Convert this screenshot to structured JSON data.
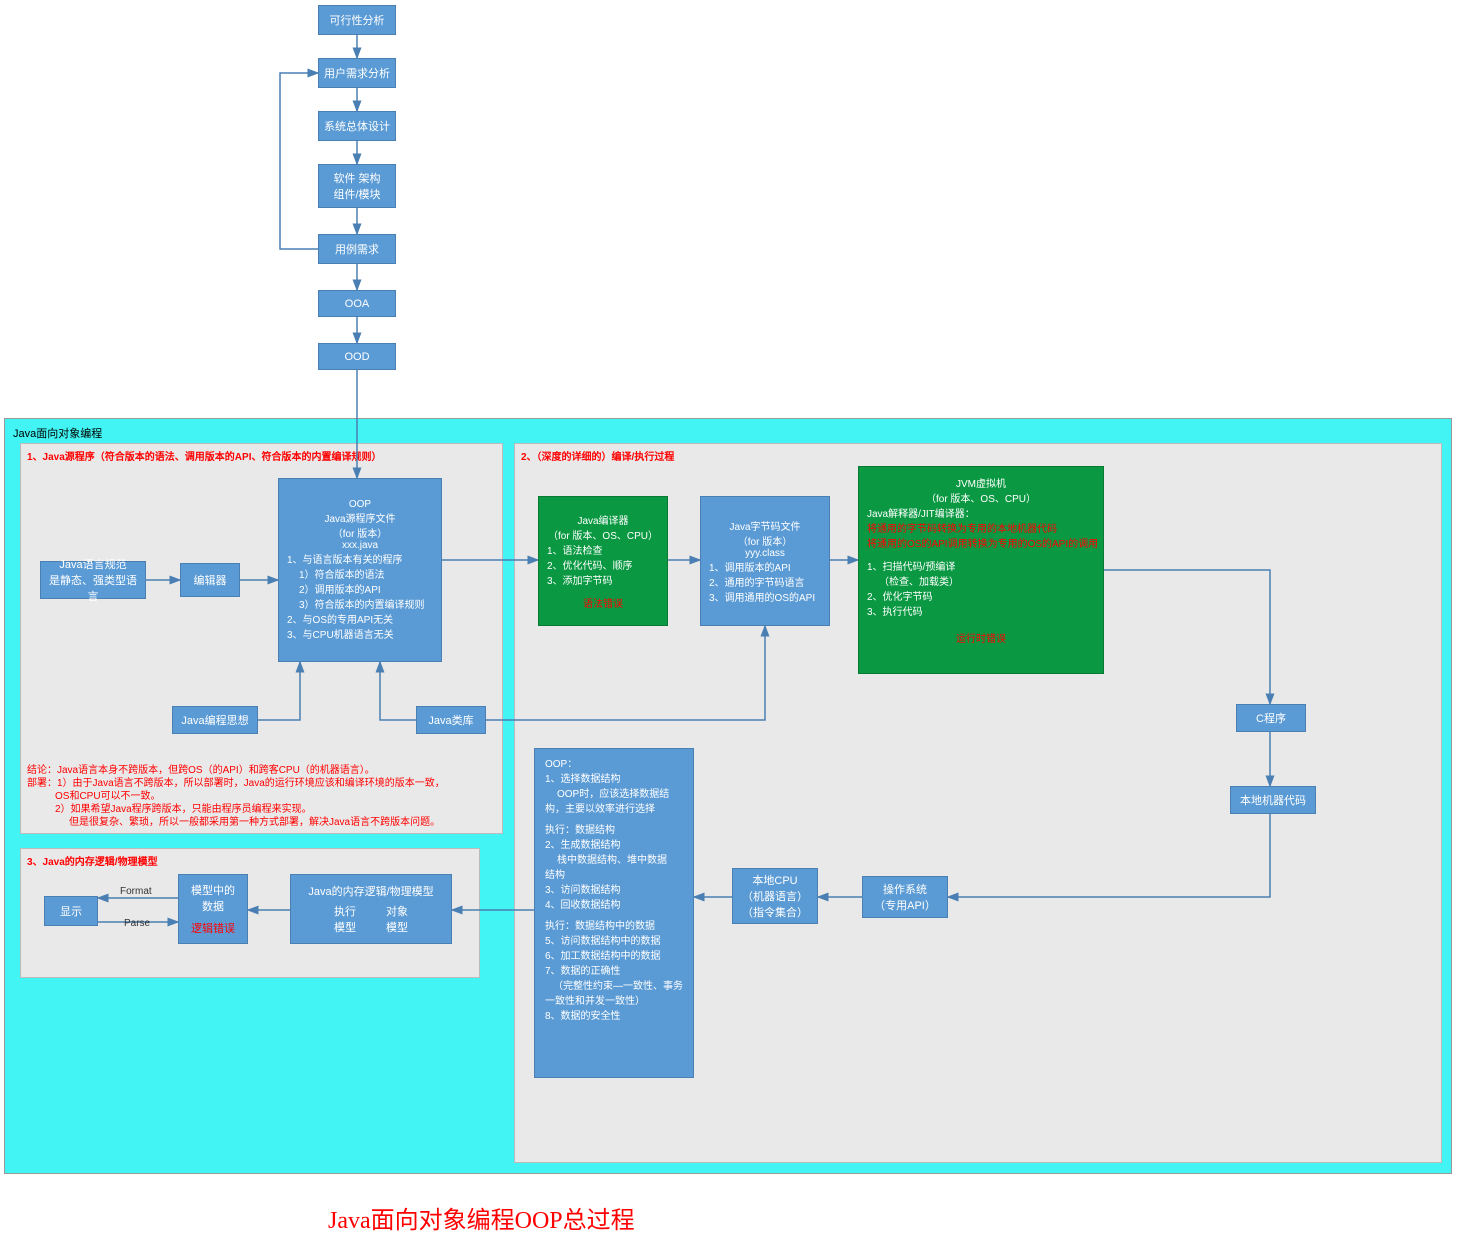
{
  "topFlow": {
    "n1": "可行性分析",
    "n2": "用户需求分析",
    "n3": "系统总体设计",
    "n4_l1": "软件 架构",
    "n4_l2": "组件/模块",
    "n5": "用例需求",
    "n6": "OOA",
    "n7": "OOD"
  },
  "container": {
    "title": "Java面向对象编程"
  },
  "panel1": {
    "title": "1、Java源程序（符合版本的语法、调用版本的API、符合版本的内置编译规则）",
    "spec_l1": "Java语言规范",
    "spec_l2": "是静态、强类型语言",
    "editor": "编辑器",
    "oop_l1": "OOP",
    "oop_l2": "Java源程序文件",
    "oop_l3": "（for 版本）",
    "oop_l4": "xxx.java",
    "oop_l5": "1、与语言版本有关的程序",
    "oop_l6": "1）符合版本的语法",
    "oop_l7": "2）调用版本的API",
    "oop_l8": "3）符合版本的内置编译规则",
    "oop_l9": "2、与OS的专用API无关",
    "oop_l10": "3、与CPU机器语言无关",
    "thought": "Java编程思想",
    "lib": "Java类库",
    "note_l1": "结论：Java语言本身不跨版本，但跨OS（的API）和跨客CPU（的机器语言）。",
    "note_l2": "部署：1）由于Java语言不跨版本，所以部署时，Java的运行环境应该和编译环境的版本一致，",
    "note_l3": "OS和CPU可以不一致。",
    "note_l4": "2）如果希望Java程序跨版本，只能由程序员编程来实现。",
    "note_l5": "但是很复杂、繁琐，所以一般都采用第一种方式部署，解决Java语言不跨版本问题。"
  },
  "panel2": {
    "title": "2、（深度的详细的）编译/执行过程",
    "compiler_l1": "Java编译器",
    "compiler_l2": "（for 版本、OS、CPU）",
    "compiler_l3": "1、语法检查",
    "compiler_l4": "2、优化代码、顺序",
    "compiler_l5": "3、添加字节码",
    "compiler_err": "语法错误",
    "bytecode_l1": "Java字节码文件",
    "bytecode_l2": "（for 版本）",
    "bytecode_l3": "yyy.class",
    "bytecode_l4": "1、调用版本的API",
    "bytecode_l5": "2、通用的字节码语言",
    "bytecode_l6": "3、调用通用的OS的API",
    "jvm_l1": "JVM虚拟机",
    "jvm_l2": "（for 版本、OS、CPU）",
    "jvm_l3": "Java解释器/JIT编译器：",
    "jvm_l4": "将通用的字节码转换为专用的本地机器代码",
    "jvm_l5": "将通用的OS的API调用转换为专用的OS的API的调用",
    "jvm_l6": "1、扫描代码/预编译",
    "jvm_l7": "（检查、加载类）",
    "jvm_l8": "2、优化字节码",
    "jvm_l9": "3、执行代码",
    "jvm_err": "运行时错误",
    "cprog": "C程序",
    "native": "本地机器代码",
    "os_l1": "操作系统",
    "os_l2": "（专用API）",
    "cpu_l1": "本地CPU",
    "cpu_l2": "（机器语言）",
    "cpu_l3": "（指令集合）",
    "oopexec_l1": "OOP：",
    "oopexec_l2": "1、选择数据结构",
    "oopexec_l3": "OOP时，应该选择数据结",
    "oopexec_l4": "构，主要以效率进行选择",
    "oopexec_l5": "执行：数据结构",
    "oopexec_l6": "2、生成数据结构",
    "oopexec_l7": "栈中数据结构、堆中数据",
    "oopexec_l8": "结构",
    "oopexec_l9": "3、访问数据结构",
    "oopexec_l10": "4、回收数据结构",
    "oopexec_l11": "执行：数据结构中的数据",
    "oopexec_l12": "5、访问数据结构中的数据",
    "oopexec_l13": "6、加工数据结构中的数据",
    "oopexec_l14": "7、数据的正确性",
    "oopexec_l15": "（完整性约束—一致性、事务",
    "oopexec_l16": "一致性和并发一致性）",
    "oopexec_l17": "8、数据的安全性"
  },
  "panel3": {
    "title": "3、Java的内存逻辑/物理模型",
    "display": "显示",
    "format": "Format",
    "parse": "Parse",
    "modeldata_l1": "模型中的",
    "modeldata_l2": "数据",
    "modeldata_err": "逻辑错误",
    "memmodel_l1": "Java的内存逻辑/物理模型",
    "memmodel_l2": "执行",
    "memmodel_l3": "对象",
    "memmodel_l4": "模型",
    "memmodel_l5": "模型"
  },
  "footer": "Java面向对象编程OOP总过程"
}
